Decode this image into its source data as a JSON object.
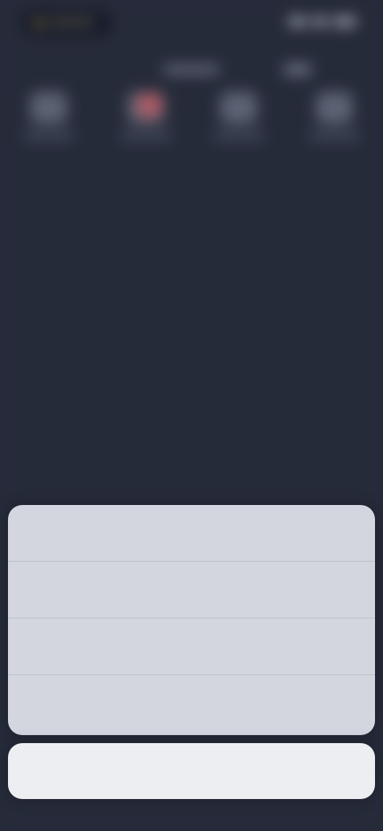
{
  "colors": {
    "background": "#262b3a",
    "sheet_background": "#d3d6de",
    "cancel_background": "#eceef2",
    "action_text": "#1f7ae0"
  },
  "background_app": {
    "icons": [
      {
        "name": "app-icon-1"
      },
      {
        "name": "app-icon-2"
      },
      {
        "name": "app-icon-3"
      },
      {
        "name": "app-icon-4"
      }
    ]
  },
  "action_sheet": {
    "options": [
      {
        "label": ""
      },
      {
        "label": ""
      },
      {
        "label": ""
      },
      {
        "label": ""
      }
    ],
    "cancel_label": ""
  }
}
